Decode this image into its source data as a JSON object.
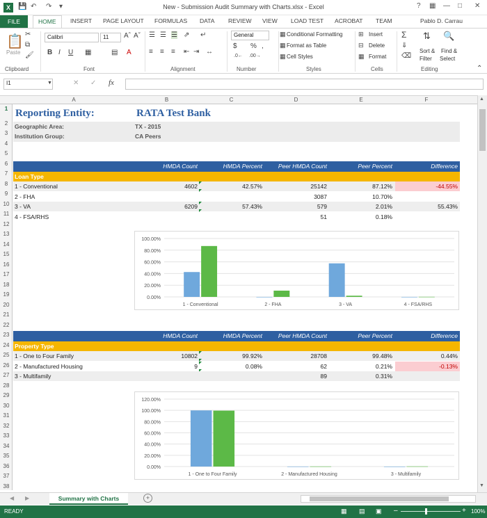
{
  "window": {
    "title": "New - Submission Audit Summary with Charts.xlsx - Excel",
    "user": "Pablo D. Carrau"
  },
  "tabs": [
    "FILE",
    "HOME",
    "INSERT",
    "PAGE LAYOUT",
    "FORMULAS",
    "DATA",
    "REVIEW",
    "VIEW",
    "LOAD TEST",
    "ACROBAT",
    "TEAM"
  ],
  "ribbon": {
    "clipboard": {
      "paste": "Paste",
      "label": "Clipboard"
    },
    "font": {
      "name": "Calibri",
      "size": "11",
      "label": "Font"
    },
    "alignment": {
      "label": "Alignment"
    },
    "number": {
      "format": "General",
      "label": "Number"
    },
    "styles": {
      "cond": "Conditional Formatting",
      "table": "Format as Table",
      "cell": "Cell Styles",
      "label": "Styles"
    },
    "cells": {
      "insert": "Insert",
      "delete": "Delete",
      "format": "Format",
      "label": "Cells"
    },
    "editing": {
      "sort": "Sort &",
      "filter": "Filter",
      "find": "Find &",
      "select": "Select",
      "label": "Editing"
    }
  },
  "formula_bar": {
    "name_box": "I1",
    "fx": "fx",
    "value": ""
  },
  "columns": [
    "A",
    "B",
    "C",
    "D",
    "E",
    "F"
  ],
  "rows": [
    "1",
    "2",
    "3",
    "4",
    "5",
    "6",
    "7",
    "8",
    "9",
    "10",
    "11",
    "12",
    "13",
    "14",
    "15",
    "16",
    "17",
    "18",
    "19",
    "20",
    "21",
    "22",
    "23",
    "24",
    "25",
    "26",
    "27",
    "28",
    "29",
    "30",
    "31",
    "32",
    "33",
    "34",
    "35",
    "36",
    "37",
    "38"
  ],
  "sheet": {
    "reporting_label": "Reporting Entity:",
    "reporting_value": "RATA Test Bank",
    "geo_label": "Geographic Area:",
    "geo_value": "TX - 2015",
    "inst_label": "Institution Group:",
    "inst_value": "CA Peers",
    "headers": [
      "HMDA Count",
      "HMDA Percent",
      "Peer HMDA Count",
      "Peer Percent",
      "Difference"
    ],
    "loan_type": "Loan Type",
    "loan_rows": [
      {
        "label": "1 - Conventional",
        "count": "4602",
        "pct": "42.57%",
        "peer_count": "25142",
        "peer_pct": "87.12%",
        "diff": "-44.55%"
      },
      {
        "label": "2 - FHA",
        "count": "",
        "pct": "",
        "peer_count": "3087",
        "peer_pct": "10.70%",
        "diff": ""
      },
      {
        "label": "3 - VA",
        "count": "6209",
        "pct": "57.43%",
        "peer_count": "579",
        "peer_pct": "2.01%",
        "diff": "55.43%"
      },
      {
        "label": "4 - FSA/RHS",
        "count": "",
        "pct": "",
        "peer_count": "51",
        "peer_pct": "0.18%",
        "diff": ""
      }
    ],
    "property_type": "Property Type",
    "prop_rows": [
      {
        "label": "1 - One to Four Family",
        "count": "10802",
        "pct": "99.92%",
        "peer_count": "28708",
        "peer_pct": "99.48%",
        "diff": "0.44%"
      },
      {
        "label": "2 - Manufactured Housing",
        "count": "9",
        "pct": "0.08%",
        "peer_count": "62",
        "peer_pct": "0.21%",
        "diff": "-0.13%"
      },
      {
        "label": "3 - Multifamily",
        "count": "",
        "pct": "",
        "peer_count": "89",
        "peer_pct": "0.31%",
        "diff": ""
      }
    ]
  },
  "chart_data": [
    {
      "type": "bar",
      "categories": [
        "1 - Conventional",
        "2 - FHA",
        "3 - VA",
        "4 - FSA/RHS"
      ],
      "series": [
        {
          "values": [
            42.57,
            0,
            57.43,
            0
          ]
        },
        {
          "values": [
            87.12,
            10.7,
            2.01,
            0.18
          ]
        }
      ],
      "yticks": [
        "100.00%",
        "80.00%",
        "60.00%",
        "40.00%",
        "20.00%",
        "0.00%"
      ],
      "ylim": [
        0,
        100
      ]
    },
    {
      "type": "bar",
      "categories": [
        "1 - One to Four Family",
        "2 - Manufactured Housing",
        "3 - Multifamily"
      ],
      "series": [
        {
          "values": [
            99.92,
            0.08,
            0
          ]
        },
        {
          "values": [
            99.48,
            0.21,
            0.31
          ]
        }
      ],
      "yticks": [
        "120.00%",
        "100.00%",
        "80.00%",
        "60.00%",
        "40.00%",
        "20.00%",
        "0.00%"
      ],
      "ylim": [
        0,
        120
      ]
    }
  ],
  "colors": {
    "series1": "#6fa8dc",
    "series2": "#5cb947",
    "header": "#2e5fa1",
    "band": "#f5b600",
    "excel": "#217346"
  },
  "sheet_tab": "Summary with Charts",
  "status": {
    "ready": "READY",
    "zoom": "100%"
  }
}
